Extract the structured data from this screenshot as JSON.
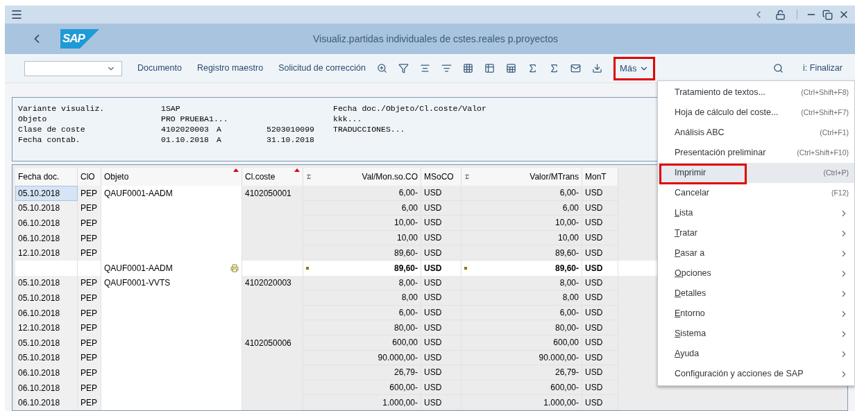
{
  "window": {
    "title": "Visualiz.partidas individuales de cstes.reales p.proyectos"
  },
  "logo": "SAP",
  "toolbar": {
    "buttons": [
      "Documento",
      "Registro maestro",
      "Solicitud de corrección"
    ],
    "more": {
      "label": "Más",
      "annotated": true
    },
    "exit": "i: Finalizar"
  },
  "header_info": [
    {
      "label": "Variante visualiz.",
      "value": "1SAP",
      "right": "Fecha doc./Objeto/Cl.coste/Valor"
    },
    {
      "label": "Objeto",
      "value": "PRO PRUEBA1...",
      "right": "kkk..."
    },
    {
      "label": "Clase de coste",
      "value": "4102020003",
      "connector": "A",
      "value_to": "5203010099",
      "right": "TRADUCCIONES..."
    },
    {
      "label": "Fecha contab.",
      "value": "01.10.2018",
      "connector": "A",
      "value_to": "31.10.2018"
    }
  ],
  "table": {
    "columns": [
      {
        "label": "Fecha doc.",
        "sorted": false,
        "sum": false
      },
      {
        "label": "ClO",
        "sorted": false,
        "sum": false
      },
      {
        "label": "Objeto",
        "sorted": true,
        "sum": false
      },
      {
        "label": "Cl.coste",
        "sorted": true,
        "sum": false
      },
      {
        "label": "Val/Mon.so.CO",
        "sorted": false,
        "sum": true
      },
      {
        "label": "MSoCO",
        "sorted": false,
        "sum": false
      },
      {
        "label": "Valor/MTrans",
        "sorted": false,
        "sum": true
      },
      {
        "label": "MonT",
        "sorted": false,
        "sum": false
      }
    ],
    "rows": [
      {
        "kind": "item",
        "focused": true,
        "cells": [
          "05.10.2018",
          "PEP",
          "QAUF0001-AADM",
          "4102050001",
          "6,00-",
          "USD",
          "6,00-",
          "USD"
        ]
      },
      {
        "kind": "item",
        "focused": false,
        "cells": [
          "05.10.2018",
          "PEP",
          "",
          "",
          "6,00",
          "USD",
          "6,00",
          "USD"
        ]
      },
      {
        "kind": "item",
        "focused": false,
        "cells": [
          "06.10.2018",
          "PEP",
          "",
          "",
          "10,00-",
          "USD",
          "10,00-",
          "USD"
        ]
      },
      {
        "kind": "item",
        "focused": false,
        "cells": [
          "06.10.2018",
          "PEP",
          "",
          "",
          "10,00",
          "USD",
          "10,00",
          "USD"
        ]
      },
      {
        "kind": "item",
        "focused": false,
        "cells": [
          "12.10.2018",
          "PEP",
          "",
          "",
          "89,60-",
          "USD",
          "89,60-",
          "USD"
        ]
      },
      {
        "kind": "subtotal",
        "focused": false,
        "cells": [
          "",
          "",
          "QAUF0001-AADM",
          "",
          "89,60-",
          "USD",
          "89,60-",
          "USD"
        ]
      },
      {
        "kind": "item",
        "focused": false,
        "cells": [
          "05.10.2018",
          "PEP",
          "QAUF0001-VVTS",
          "4102020003",
          "8,00-",
          "USD",
          "8,00-",
          "USD"
        ]
      },
      {
        "kind": "item",
        "focused": false,
        "cells": [
          "05.10.2018",
          "PEP",
          "",
          "",
          "8,00",
          "USD",
          "8,00",
          "USD"
        ]
      },
      {
        "kind": "item",
        "focused": false,
        "cells": [
          "06.10.2018",
          "PEP",
          "",
          "",
          "6,00-",
          "USD",
          "6,00-",
          "USD"
        ]
      },
      {
        "kind": "item",
        "focused": false,
        "cells": [
          "12.10.2018",
          "PEP",
          "",
          "",
          "80,00-",
          "USD",
          "80,00-",
          "USD"
        ]
      },
      {
        "kind": "item",
        "focused": false,
        "cells": [
          "05.10.2018",
          "PEP",
          "",
          "4102050006",
          "600,00",
          "USD",
          "600,00",
          "USD"
        ]
      },
      {
        "kind": "item",
        "focused": false,
        "cells": [
          "05.10.2018",
          "PEP",
          "",
          "",
          "90.000,00-",
          "USD",
          "90.000,00-",
          "USD"
        ]
      },
      {
        "kind": "item",
        "focused": false,
        "cells": [
          "06.10.2018",
          "PEP",
          "",
          "",
          "26,79-",
          "USD",
          "26,79-",
          "USD"
        ]
      },
      {
        "kind": "item",
        "focused": false,
        "cells": [
          "06.10.2018",
          "PEP",
          "",
          "",
          "600,00-",
          "USD",
          "600,00-",
          "USD"
        ]
      },
      {
        "kind": "item",
        "focused": false,
        "cells": [
          "06.10.2018",
          "PEP",
          "",
          "",
          "1.000,00-",
          "USD",
          "1.000,00-",
          "USD"
        ]
      }
    ]
  },
  "menu": [
    {
      "kind": "action",
      "label": "Tratamiento de textos...",
      "shortcut": "(Ctrl+Shift+F8)",
      "selected": false,
      "annotated": false,
      "underline_first": false
    },
    {
      "kind": "action",
      "label": "Hoja de cálculo del coste...",
      "shortcut": "(Ctrl+Shift+F7)",
      "selected": false,
      "annotated": false,
      "underline_first": false
    },
    {
      "kind": "action",
      "label": "Análisis ABC",
      "shortcut": "(Ctrl+F1)",
      "selected": false,
      "annotated": false,
      "underline_first": false
    },
    {
      "kind": "action",
      "label": "Presentación preliminar",
      "shortcut": "(Ctrl+Shift+F10)",
      "selected": false,
      "annotated": false,
      "underline_first": false
    },
    {
      "kind": "action",
      "label": "Imprimir",
      "shortcut": "(Ctrl+P)",
      "selected": true,
      "annotated": true,
      "underline_first": false
    },
    {
      "kind": "action",
      "label": "Cancelar",
      "shortcut": "(F12)",
      "selected": false,
      "annotated": false,
      "underline_first": false
    },
    {
      "kind": "submenu",
      "label": "Lista",
      "selected": false,
      "annotated": false,
      "underline_first": true
    },
    {
      "kind": "submenu",
      "label": "Tratar",
      "selected": false,
      "annotated": false,
      "underline_first": true
    },
    {
      "kind": "submenu",
      "label": "Pasar a",
      "selected": false,
      "annotated": false,
      "underline_first": true
    },
    {
      "kind": "submenu",
      "label": "Opciones",
      "selected": false,
      "annotated": false,
      "underline_first": true
    },
    {
      "kind": "submenu",
      "label": "Detalles",
      "selected": false,
      "annotated": false,
      "underline_first": true
    },
    {
      "kind": "submenu",
      "label": "Entorno",
      "selected": false,
      "annotated": false,
      "underline_first": true
    },
    {
      "kind": "submenu",
      "label": "Sistema",
      "selected": false,
      "annotated": false,
      "underline_first": true
    },
    {
      "kind": "submenu",
      "label": "Ayuda",
      "selected": false,
      "annotated": false,
      "underline_first": true
    },
    {
      "kind": "submenu",
      "label": "Configuración y acciones de SAP",
      "selected": false,
      "annotated": false,
      "underline_first": false
    }
  ]
}
